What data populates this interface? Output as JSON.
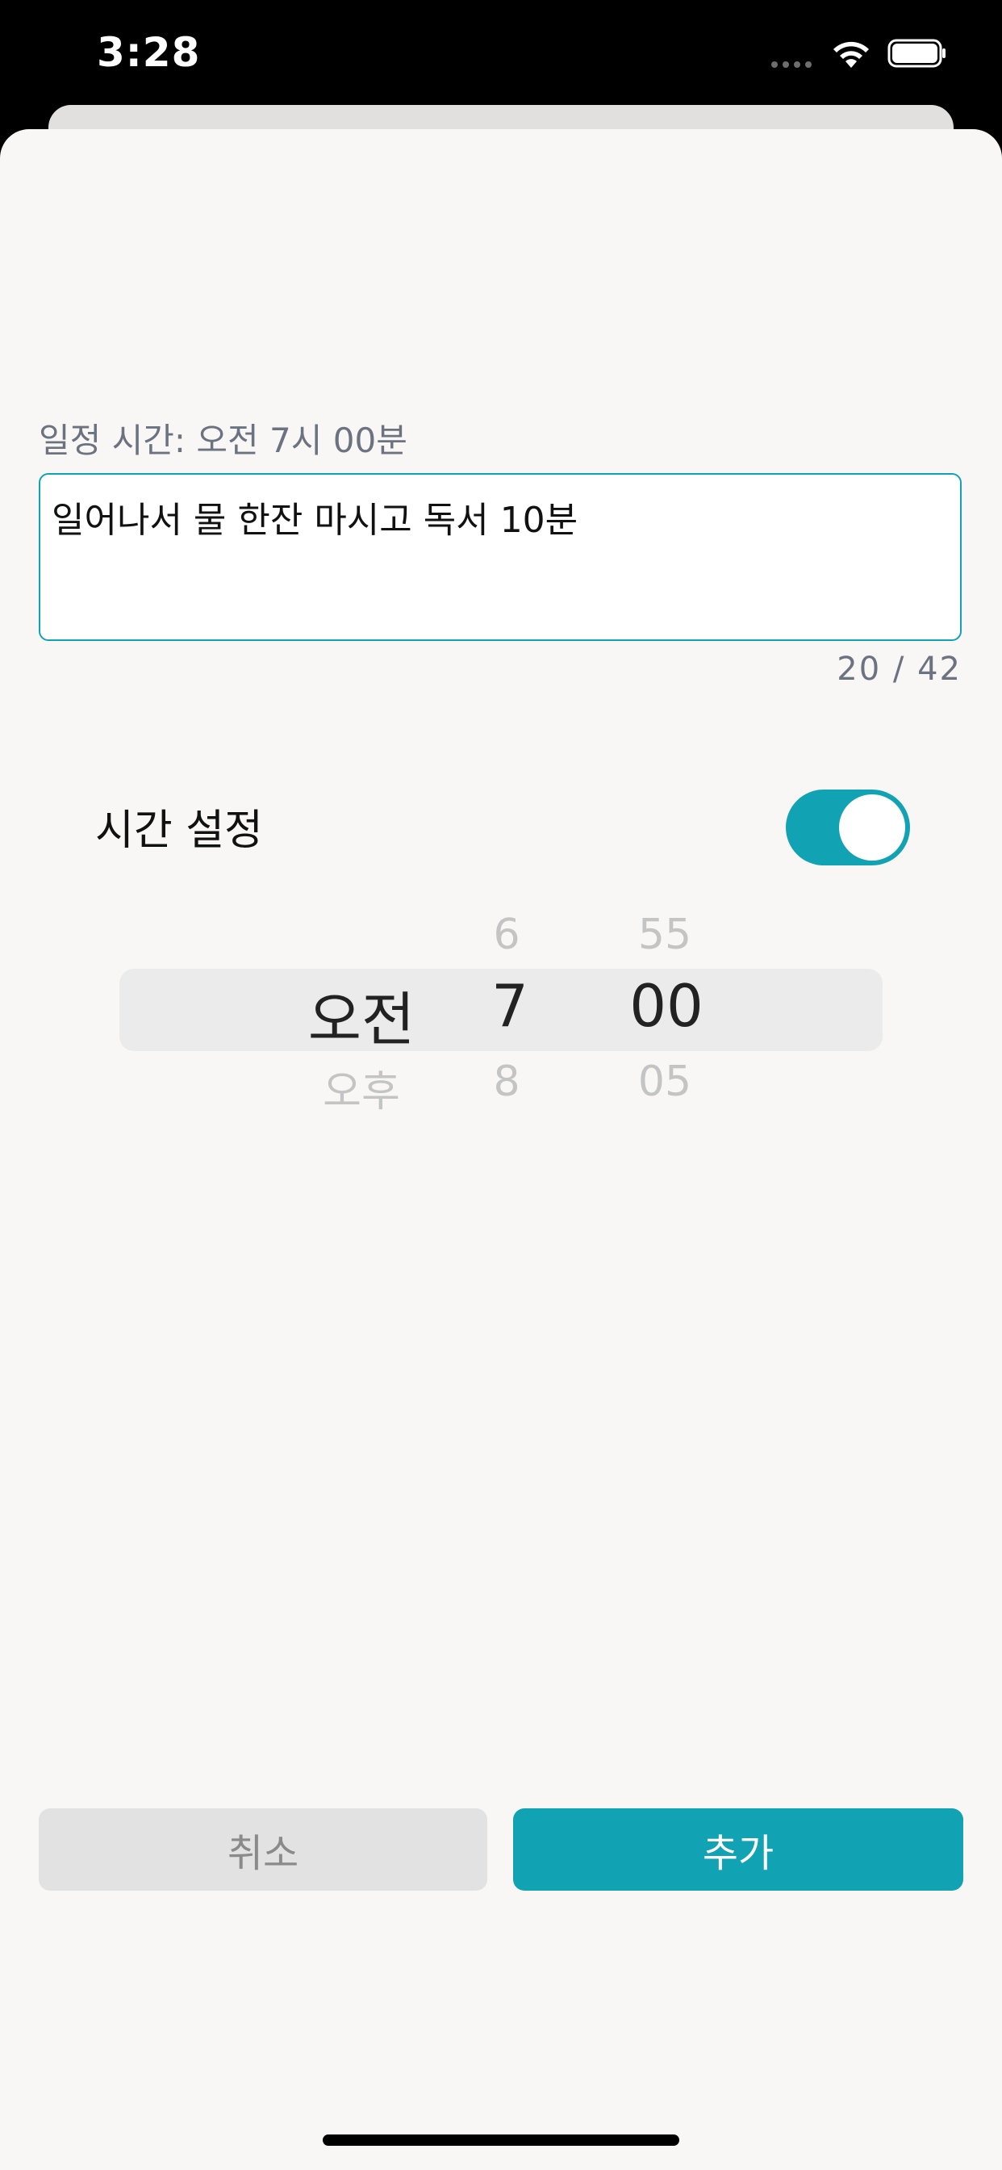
{
  "status_bar": {
    "time": "3:28"
  },
  "form": {
    "schedule_label": "일정 시간: 오전 7시 00분",
    "memo_text": "일어나서 물 한잔 마시고 독서 10분",
    "char_counter": "20 / 42",
    "time_setting_label": "시간 설정",
    "time_setting_enabled": true
  },
  "picker": {
    "period": {
      "prev": "",
      "selected": "오전",
      "next": "오후"
    },
    "hour": {
      "prev": "6",
      "selected": "7",
      "next": "8"
    },
    "minute": {
      "prev": "55",
      "selected": "00",
      "next": "05"
    }
  },
  "buttons": {
    "cancel_label": "취소",
    "add_label": "추가"
  },
  "colors": {
    "accent": "#11a3b4",
    "background": "#f8f7f5"
  },
  "icons": {
    "wifi": "wifi-icon",
    "battery": "battery-icon"
  }
}
